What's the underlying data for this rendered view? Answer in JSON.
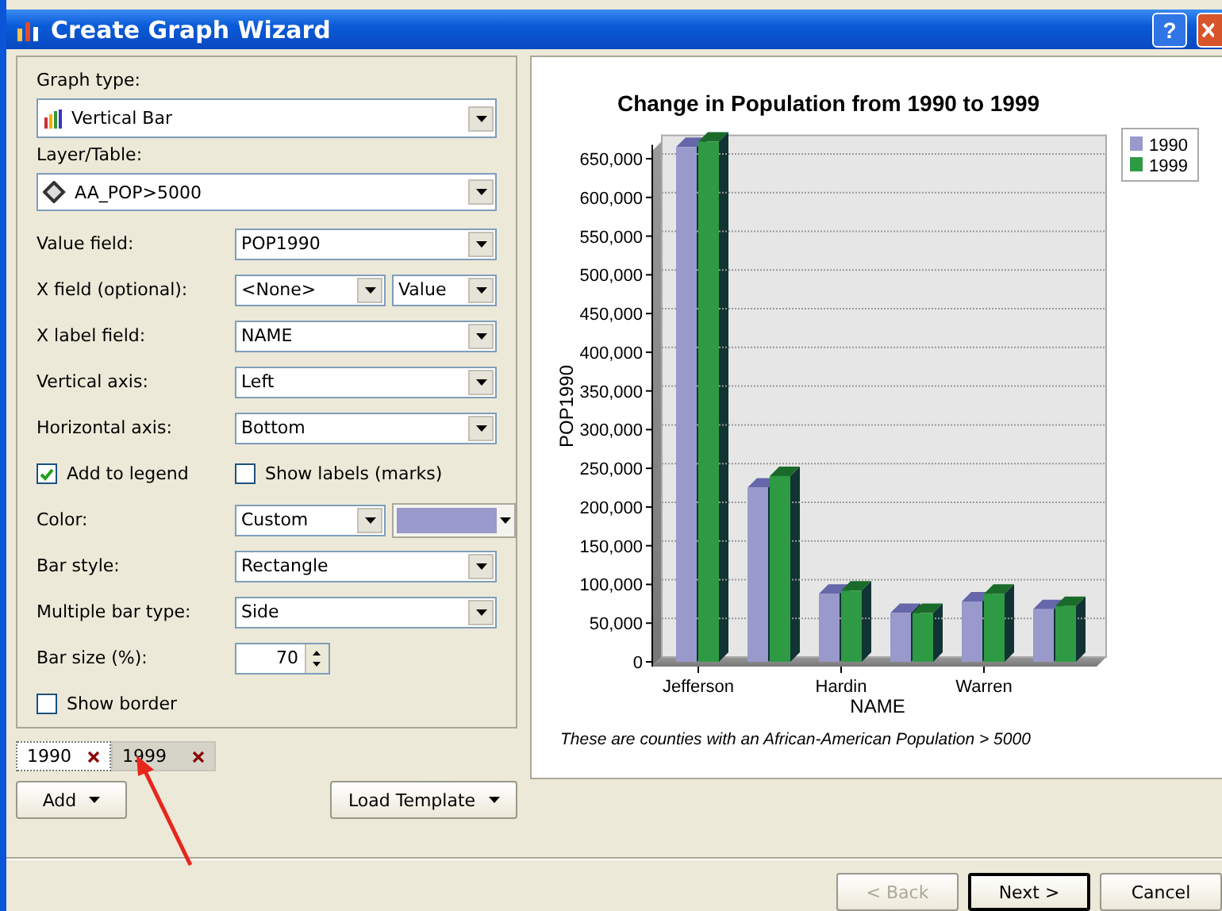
{
  "window": {
    "title": "Create Graph Wizard",
    "help": "?"
  },
  "form": {
    "graph_type": {
      "label": "Graph type:",
      "value": "Vertical Bar"
    },
    "layer_table": {
      "label": "Layer/Table:",
      "value": "AA_POP>5000"
    },
    "rows": [
      {
        "kind": "combo",
        "label": "Value field:",
        "value": "POP1990"
      },
      {
        "kind": "combo_pair",
        "label": "X field (optional):",
        "value": "<None>",
        "value2": "Value"
      },
      {
        "kind": "combo",
        "label": "X label field:",
        "value": "NAME"
      },
      {
        "kind": "combo",
        "label": "Vertical axis:",
        "value": "Left"
      },
      {
        "kind": "combo",
        "label": "Horizontal axis:",
        "value": "Bottom"
      },
      {
        "kind": "checks",
        "label": "Add to legend",
        "checked": true,
        "label2": "Show labels (marks)",
        "checked2": false
      },
      {
        "kind": "color",
        "label": "Color:",
        "value": "Custom",
        "color": "#9999cc"
      },
      {
        "kind": "combo",
        "label": "Bar style:",
        "value": "Rectangle"
      },
      {
        "kind": "combo",
        "label": "Multiple bar type:",
        "value": "Side"
      },
      {
        "kind": "spin",
        "label": "Bar size (%):",
        "value": "70"
      },
      {
        "kind": "check",
        "label": "Show border",
        "checked": false
      }
    ]
  },
  "series_tabs": [
    {
      "label": "1990",
      "selected": true
    },
    {
      "label": "1999",
      "selected": false
    }
  ],
  "add_button": "Add",
  "load_template_button": "Load Template",
  "chart": {
    "chart_data": {
      "type": "bar",
      "title": "Change in Population from 1990 to 1999",
      "xlabel": "NAME",
      "ylabel": "POP1990",
      "categories": [
        "Jefferson",
        null,
        "Hardin",
        null,
        "Warren",
        null
      ],
      "stacked": false,
      "legend": true,
      "ylim": [
        0,
        674000
      ],
      "yticks": [
        {
          "value": 0,
          "label": "0"
        },
        {
          "value": 50000,
          "label": "50,000"
        },
        {
          "value": 100000,
          "label": "100,000"
        },
        {
          "value": 150000,
          "label": "150,000"
        },
        {
          "value": 200000,
          "label": "200,000"
        },
        {
          "value": 250000,
          "label": "250,000"
        },
        {
          "value": 300000,
          "label": "300,000"
        },
        {
          "value": 350000,
          "label": "350,000"
        },
        {
          "value": 400000,
          "label": "400,000"
        },
        {
          "value": 450000,
          "label": "450,000"
        },
        {
          "value": 500000,
          "label": "500,000"
        },
        {
          "value": 550000,
          "label": "550,000"
        },
        {
          "value": 600000,
          "label": "600,000"
        },
        {
          "value": 650000,
          "label": "650,000"
        }
      ],
      "series": [
        {
          "name": "1990",
          "color": "#9999cc",
          "values": [
            665000,
            225000,
            88000,
            63000,
            78000,
            68000
          ]
        },
        {
          "name": "1999",
          "color": "#2e9a44",
          "values": [
            672000,
            240000,
            92000,
            63000,
            88000,
            72000
          ]
        }
      ]
    },
    "caption": "These are counties with an African-American Population > 5000"
  },
  "nav_buttons": [
    {
      "label": "< Back",
      "disabled": true,
      "default": false
    },
    {
      "label": "Next >",
      "disabled": false,
      "default": true
    },
    {
      "label": "Cancel",
      "disabled": false,
      "default": false
    }
  ]
}
